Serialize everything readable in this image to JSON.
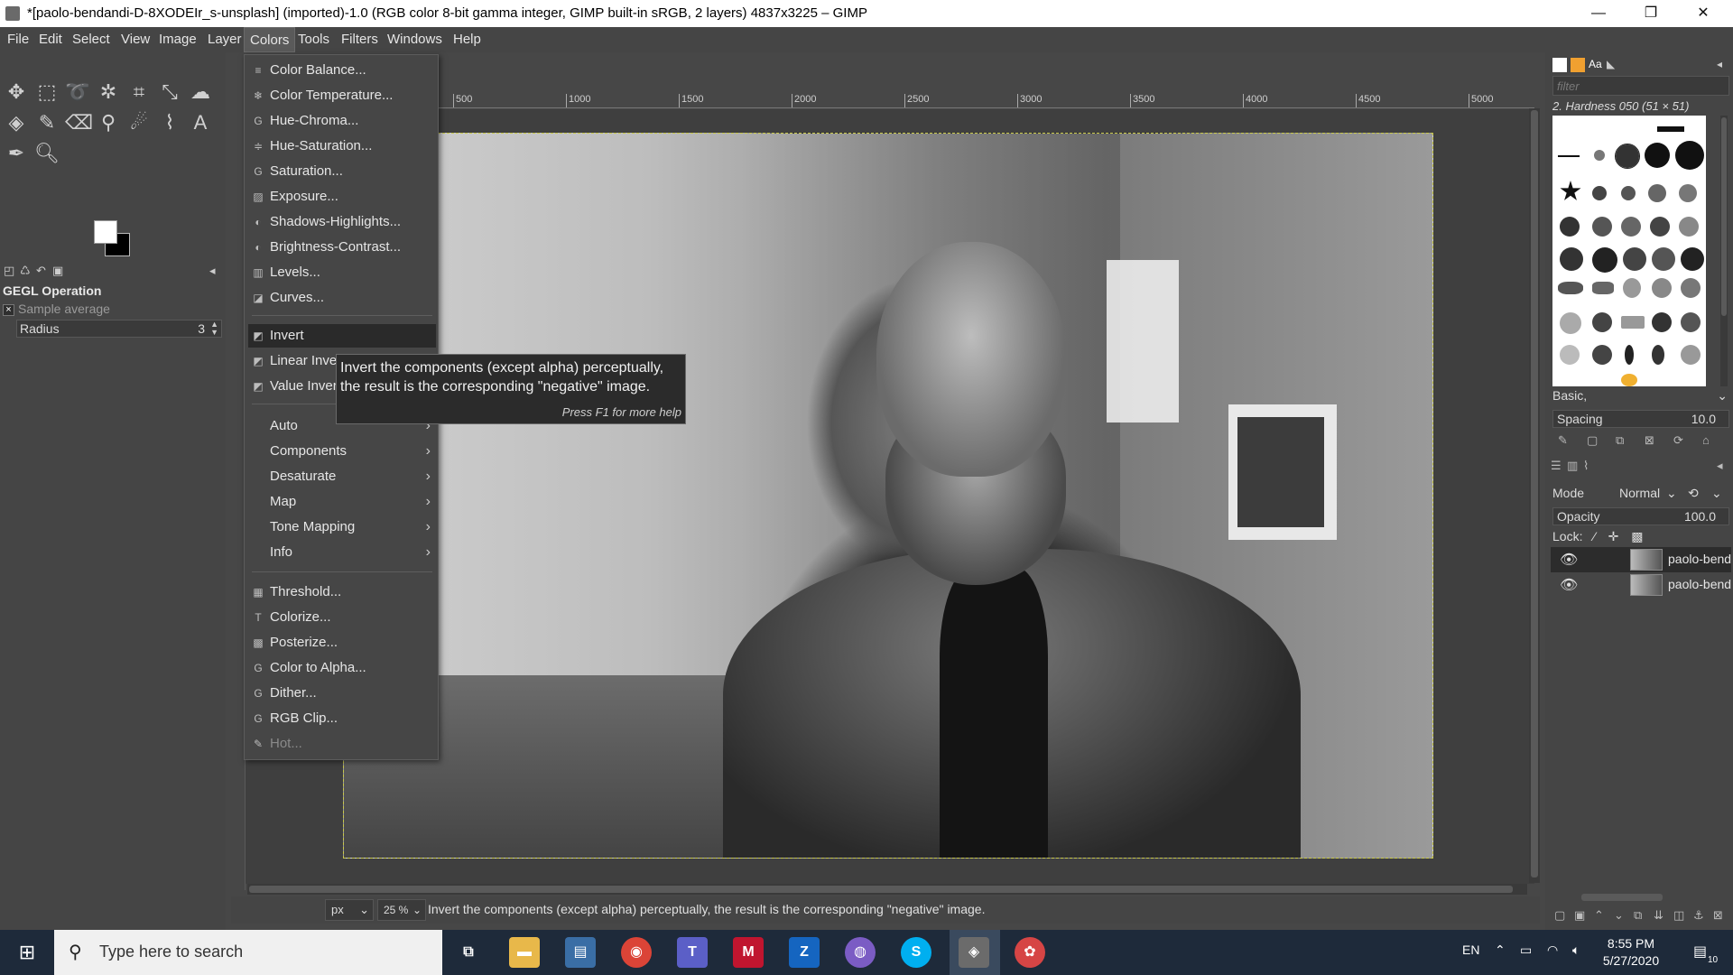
{
  "window": {
    "title": "*[paolo-bendandi-D-8XODEIr_s-unsplash] (imported)-1.0 (RGB color 8-bit gamma integer, GIMP built-in sRGB, 2 layers) 4837x3225 – GIMP",
    "minimize": "—",
    "maximize": "❐",
    "close": "✕"
  },
  "menubar": [
    "File",
    "Edit",
    "Select",
    "View",
    "Image",
    "Layer",
    "Colors",
    "Tools",
    "Filters",
    "Windows",
    "Help"
  ],
  "toolbox": {
    "options_title": "GEGL Operation",
    "sample_average": "Sample average",
    "radius_label": "Radius",
    "radius_value": "3"
  },
  "ruler": {
    "marks": [
      "500",
      "1000",
      "1500",
      "2000",
      "2500",
      "3000",
      "3500",
      "4000",
      "4500",
      "5000"
    ]
  },
  "colors_menu": {
    "items": [
      {
        "label": "Color Balance...",
        "icon": "≡"
      },
      {
        "label": "Color Temperature...",
        "icon": "❄"
      },
      {
        "label": "Hue-Chroma...",
        "icon": "G"
      },
      {
        "label": "Hue-Saturation...",
        "icon": "≑"
      },
      {
        "label": "Saturation...",
        "icon": "G"
      },
      {
        "label": "Exposure...",
        "icon": "▨"
      },
      {
        "label": "Shadows-Highlights...",
        "icon": "◐"
      },
      {
        "label": "Brightness-Contrast...",
        "icon": "◐"
      },
      {
        "label": "Levels...",
        "icon": "▥"
      },
      {
        "label": "Curves...",
        "icon": "◪"
      },
      {
        "label": "Invert",
        "icon": "◩"
      },
      {
        "label": "Linear Invert",
        "icon": "◩"
      },
      {
        "label": "Value Invert",
        "icon": "◩"
      },
      {
        "label": "Auto",
        "icon": ""
      },
      {
        "label": "Components",
        "icon": ""
      },
      {
        "label": "Desaturate",
        "icon": ""
      },
      {
        "label": "Map",
        "icon": ""
      },
      {
        "label": "Tone Mapping",
        "icon": ""
      },
      {
        "label": "Info",
        "icon": ""
      },
      {
        "label": "Threshold...",
        "icon": "▦"
      },
      {
        "label": "Colorize...",
        "icon": "T"
      },
      {
        "label": "Posterize...",
        "icon": "▩"
      },
      {
        "label": "Color to Alpha...",
        "icon": "G"
      },
      {
        "label": "Dither...",
        "icon": "G"
      },
      {
        "label": "RGB Clip...",
        "icon": "G"
      },
      {
        "label": "Hot...",
        "icon": "✎"
      }
    ]
  },
  "tooltip": {
    "line1": "Invert the components (except alpha) perceptually,",
    "line2": "the result is the corresponding \"negative\" image.",
    "help": "Press F1 for more help"
  },
  "statusbar": {
    "unit": "px",
    "zoom": "25 %",
    "message": "Invert the components (except alpha) perceptually, the result is the corresponding \"negative\" image."
  },
  "right_dock": {
    "filter_placeholder": "filter",
    "brush_name": "2. Hardness 050 (51 × 51)",
    "brush_preset": "Basic,",
    "spacing_label": "Spacing",
    "spacing_value": "10.0",
    "mode_label": "Mode",
    "mode_value": "Normal",
    "opacity_label": "Opacity",
    "opacity_value": "100.0",
    "lock_label": "Lock:",
    "layers": [
      "paolo-bendandi",
      "paolo-bendandi"
    ]
  },
  "taskbar": {
    "search_placeholder": "Type here to search",
    "language": "EN",
    "time": "8:55 PM",
    "date": "5/27/2020",
    "notifications": "10",
    "apps": [
      {
        "name": "task-view",
        "color": "#1e2a3a",
        "glyph": "⧉"
      },
      {
        "name": "file-explorer",
        "color": "#e8b84a",
        "glyph": "▬"
      },
      {
        "name": "office-app",
        "color": "#3a6ea5",
        "glyph": "▤"
      },
      {
        "name": "chrome",
        "color": "#db4437",
        "glyph": "◉"
      },
      {
        "name": "teams",
        "color": "#5b5fc7",
        "glyph": "T"
      },
      {
        "name": "mytools",
        "color": "#c0152f",
        "glyph": "M"
      },
      {
        "name": "zotero",
        "color": "#1565c0",
        "glyph": "Z"
      },
      {
        "name": "chat-app",
        "color": "#7b5cc4",
        "glyph": "◍"
      },
      {
        "name": "skype",
        "color": "#00aff0",
        "glyph": "S"
      },
      {
        "name": "gimp",
        "color": "#6b6b6b",
        "glyph": "◈"
      },
      {
        "name": "paint-app",
        "color": "#d64545",
        "glyph": "✿"
      }
    ]
  }
}
